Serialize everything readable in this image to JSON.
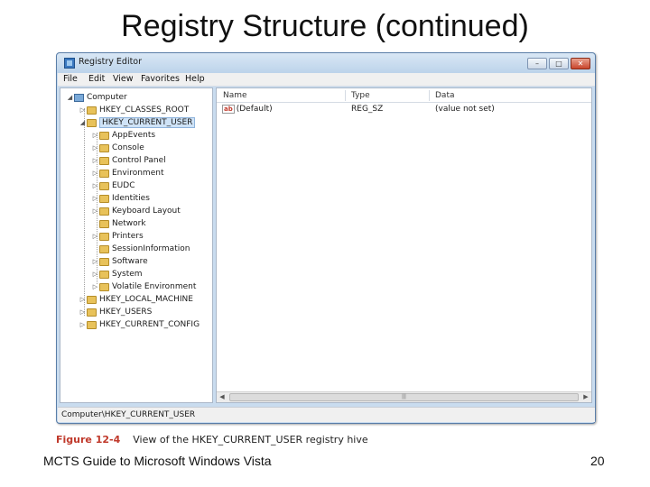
{
  "slide": {
    "title": "Registry Structure (continued)",
    "footer_left": "MCTS Guide to Microsoft Windows Vista",
    "page_number": "20"
  },
  "window": {
    "title": "Registry Editor",
    "controls": {
      "minimize": "–",
      "maximize": "□",
      "close": "✕"
    }
  },
  "menu": [
    "File",
    "Edit",
    "View",
    "Favorites",
    "Help"
  ],
  "tree": {
    "root": "Computer",
    "hives": [
      {
        "label": "HKEY_CLASSES_ROOT",
        "expanded": false
      },
      {
        "label": "HKEY_CURRENT_USER",
        "expanded": true,
        "selected": true,
        "children": [
          "AppEvents",
          "Console",
          "Control Panel",
          "Environment",
          "EUDC",
          "Identities",
          "Keyboard Layout",
          "Network",
          "Printers",
          "SessionInformation",
          "Software",
          "System",
          "Volatile Environment"
        ]
      },
      {
        "label": "HKEY_LOCAL_MACHINE",
        "expanded": false
      },
      {
        "label": "HKEY_USERS",
        "expanded": false
      },
      {
        "label": "HKEY_CURRENT_CONFIG",
        "expanded": false
      }
    ]
  },
  "list": {
    "columns": [
      "Name",
      "Type",
      "Data"
    ],
    "rows": [
      {
        "name": "(Default)",
        "type": "REG_SZ",
        "data": "(value not set)",
        "icon": "ab"
      }
    ]
  },
  "statusbar": "Computer\\HKEY_CURRENT_USER",
  "caption": {
    "label": "Figure 12-4",
    "text": "View of the HKEY_CURRENT_USER registry hive"
  },
  "colors": {
    "caption_label": "#c0392b",
    "window_border": "#5a7ea8",
    "folder": "#e8c25a"
  }
}
